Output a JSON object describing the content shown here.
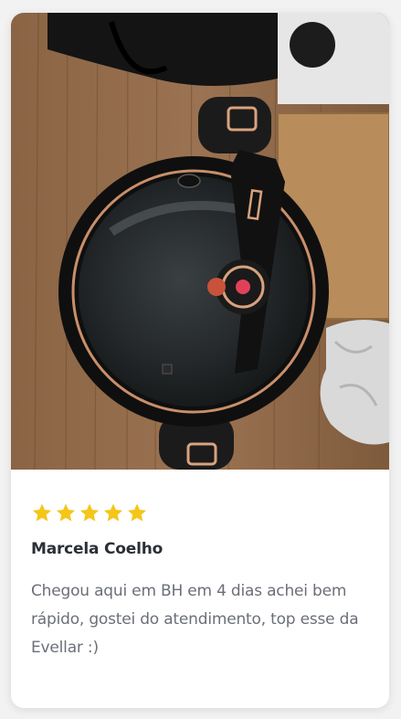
{
  "review": {
    "image": {
      "name": "product-photo",
      "alt": ""
    },
    "rating": {
      "stars": 5,
      "max": 5,
      "star_color": "#f5c518"
    },
    "author": "Marcela Coelho",
    "text": "Chegou aqui em BH em 4 dias achei bem rápido, gostei do atendimento, top esse da Evellar :)"
  }
}
